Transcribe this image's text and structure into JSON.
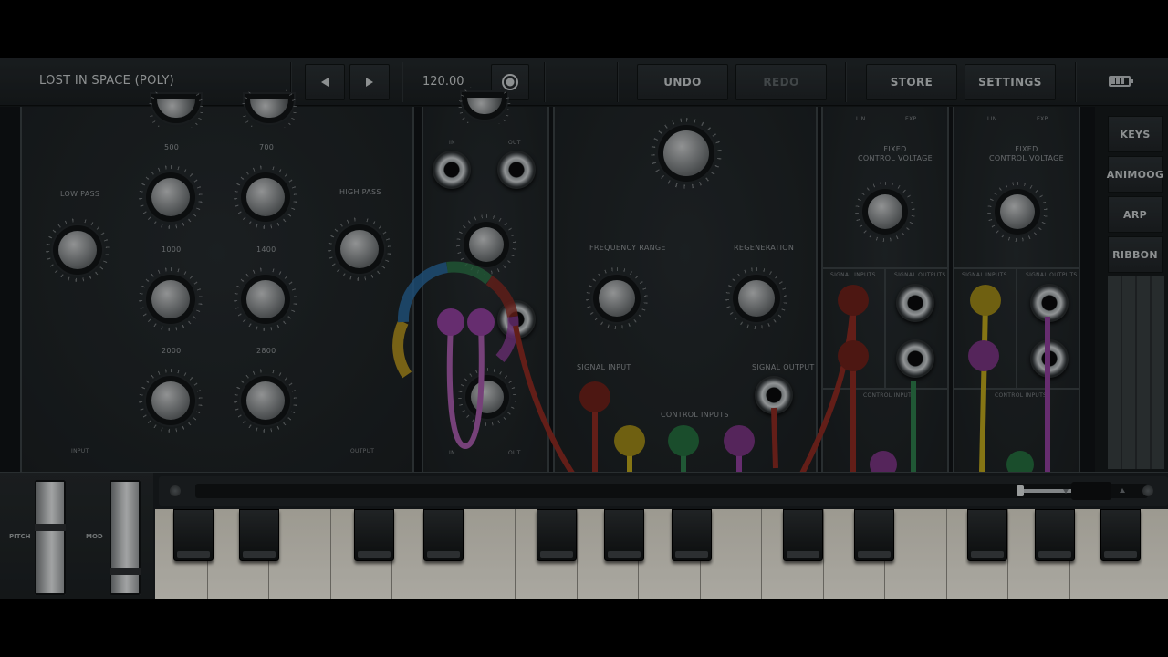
{
  "topbar": {
    "preset_name": "LOST IN SPACE (POLY)",
    "prev_icon": "triangle-left-icon",
    "next_icon": "triangle-right-icon",
    "tempo": "120.00",
    "record_icon": "record-icon",
    "undo_label": "UNDO",
    "redo_label": "REDO",
    "store_label": "STORE",
    "settings_label": "SETTINGS",
    "battery_icon": "battery-icon"
  },
  "filter_module": {
    "low_pass_label": "LOW PASS",
    "high_pass_label": "HIGH PASS",
    "band_labels": [
      "500",
      "700",
      "1000",
      "1400",
      "2000",
      "2800"
    ],
    "input_label": "INPUT",
    "output_label": "OUTPUT"
  },
  "io_module": {
    "in_label": "IN",
    "out_label": "OUT",
    "in_label_bottom": "IN",
    "out_label_bottom": "OUT"
  },
  "phaser_module": {
    "frequency_range_label": "FREQUENCY RANGE",
    "regeneration_label": "REGENERATION",
    "signal_input_label": "SIGNAL INPUT",
    "signal_output_label": "SIGNAL OUTPUT",
    "control_inputs_label": "CONTROL INPUTS"
  },
  "cv_module_1": {
    "lin_label": "LIN",
    "exp_label": "EXP",
    "fixed_cv_label": "FIXED\nCONTROL VOLTAGE",
    "signal_inputs_label": "SIGNAL   INPUTS",
    "signal_outputs_label": "SIGNAL   OUTPUTS",
    "control_inputs_label": "CONTROL INPUTS"
  },
  "cv_module_2": {
    "lin_label": "LIN",
    "exp_label": "EXP",
    "fixed_cv_label": "FIXED\nCONTROL VOLTAGE",
    "signal_inputs_label": "SIGNAL   INPUTS",
    "signal_outputs_label": "SIGNAL   OUTPUTS",
    "control_inputs_label": "CONTROL INPUTS"
  },
  "side_tabs": [
    "KEYS",
    "ANIMOOG",
    "ARP",
    "RIBBON"
  ],
  "keyboard": {
    "pitch_label": "PITCH",
    "mod_label": "MOD"
  },
  "colors": {
    "cable_red": "#8a2a22",
    "cable_purple": "#8e3f9a",
    "cable_yellow": "#b9a21c",
    "cable_green": "#2d7a4a",
    "cable_pink": "#a45aa8"
  }
}
